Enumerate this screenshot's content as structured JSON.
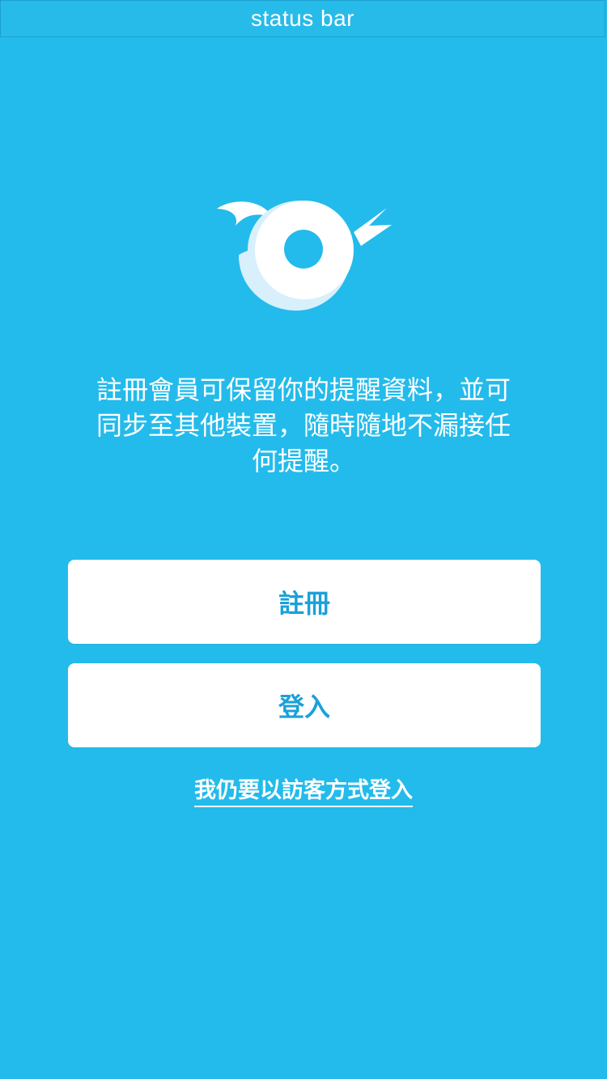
{
  "status_bar": {
    "label": "status bar"
  },
  "intro": {
    "message": "註冊會員可保留你的提醒資料，並可同步至其他裝置，隨時隨地不漏接任何提醒。"
  },
  "actions": {
    "register_label": "註冊",
    "login_label": "登入",
    "guest_label": "我仍要以訪客方式登入"
  },
  "colors": {
    "background": "#23bbeb",
    "button_text": "#1aa1d8",
    "button_background": "#ffffff",
    "logo_shadow": "#d8f0fb"
  },
  "icons": {
    "logo": "bird-logo-icon"
  }
}
